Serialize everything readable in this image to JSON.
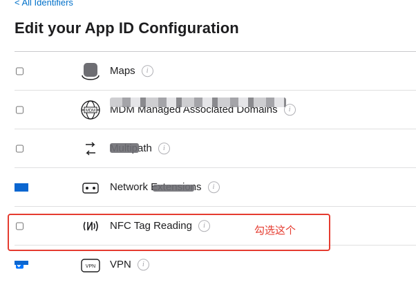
{
  "nav": {
    "back_label": "< All Identifiers"
  },
  "page": {
    "title": "Edit your App ID Configuration"
  },
  "capabilities": [
    {
      "name": "Maps",
      "icon": "maps-icon",
      "checked": false
    },
    {
      "name": "MDM Managed Associated Domains",
      "icon": "mdm-globe-icon",
      "checked": false
    },
    {
      "name": "Multipath",
      "icon": "multipath-arrows-icon",
      "checked": false
    },
    {
      "name": "Network Extensions",
      "icon": "network-extensions-icon",
      "checked": true
    },
    {
      "name": "NFC Tag Reading",
      "icon": "nfc-icon",
      "checked": false
    },
    {
      "name": "VPN",
      "icon": "vpn-icon",
      "checked": true
    }
  ],
  "info_glyph": "i",
  "annotation": {
    "text": "勾选这个",
    "color": "#e53b2f"
  },
  "colors": {
    "link": "#0070c9",
    "highlight": "#e53b2f"
  }
}
